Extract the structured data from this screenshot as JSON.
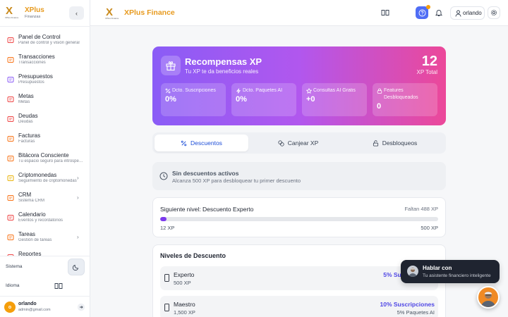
{
  "sidebar": {
    "brand_title": "XPlus",
    "brand_subtitle": "Finanzas",
    "logo_mark": "X",
    "logo_sub": "XPlus Finance",
    "items": [
      {
        "title": "Panel de Control",
        "subtitle": "Panel de control y visión general",
        "icon": "dashboard-icon",
        "color": "#ef4444",
        "chevron": false
      },
      {
        "title": "Transacciones",
        "subtitle": "Transacciones",
        "icon": "transactions-icon",
        "color": "#f97316",
        "chevron": false
      },
      {
        "title": "Presupuestos",
        "subtitle": "Presupuestos",
        "icon": "budget-icon",
        "color": "#8b5cf6",
        "chevron": false
      },
      {
        "title": "Metas",
        "subtitle": "Metas",
        "icon": "goals-icon",
        "color": "#ef4444",
        "chevron": false
      },
      {
        "title": "Deudas",
        "subtitle": "Deudas",
        "icon": "debts-icon",
        "color": "#ef4444",
        "chevron": false
      },
      {
        "title": "Facturas",
        "subtitle": "Facturas",
        "icon": "invoices-icon",
        "color": "#f97316",
        "chevron": false
      },
      {
        "title": "Bitácora Consciente",
        "subtitle": "Tu espacio seguro para introspección",
        "icon": "journal-icon",
        "color": "#f97316",
        "chevron": false
      },
      {
        "title": "Criptomonedas",
        "subtitle": "Seguimiento de criptomonedas",
        "icon": "crypto-icon",
        "color": "#eab308",
        "chevron": true
      },
      {
        "title": "CRM",
        "subtitle": "Sistema CRM",
        "icon": "crm-icon",
        "color": "#f97316",
        "chevron": true
      },
      {
        "title": "Calendario",
        "subtitle": "Eventos y recordatorios",
        "icon": "calendar-icon",
        "color": "#ef4444",
        "chevron": false
      },
      {
        "title": "Tareas",
        "subtitle": "Gestión de tareas",
        "icon": "tasks-icon",
        "color": "#f97316",
        "chevron": true
      },
      {
        "title": "Reportes",
        "subtitle": "",
        "icon": "reports-icon",
        "color": "#ef4444",
        "chevron": false
      }
    ],
    "system_label": "Sistema",
    "language_label": "Idioma",
    "user": {
      "initial": "o",
      "name": "orlando",
      "email": "admin@gmail.com"
    }
  },
  "header": {
    "logo_mark": "X",
    "logo_sub": "XPlus Finance",
    "title": "XPlus Finance",
    "user_name": "orlando",
    "help_color": "#4f6df5",
    "notification_dot_color": "#f59e0b"
  },
  "rewards": {
    "title": "Recompensas XP",
    "subtitle": "Tu XP te da beneficios reales",
    "total_value": "12",
    "total_label": "XP Total",
    "stats": [
      {
        "label": "Dcto. Suscripciones",
        "value": "0%",
        "icon": "percent-icon"
      },
      {
        "label": "Dcto. Paquetes AI",
        "value": "0%",
        "icon": "bolt-icon"
      },
      {
        "label": "Consultas AI Gratis",
        "value": "+0",
        "icon": "star-icon"
      },
      {
        "label": "Features Desbloqueados",
        "value": "0",
        "icon": "lock-icon"
      }
    ],
    "gradient": [
      "#8a5cf6",
      "#b157ee",
      "#ec4899"
    ]
  },
  "tabs": [
    {
      "label": "Descuentos",
      "icon": "percent-icon",
      "active": true
    },
    {
      "label": "Canjear XP",
      "icon": "coins-icon",
      "active": false
    },
    {
      "label": "Desbloqueos",
      "icon": "unlock-icon",
      "active": false
    }
  ],
  "empty_discounts": {
    "title": "Sin descuentos activos",
    "subtitle": "Alcanza 500 XP para desbloquear tu primer descuento"
  },
  "next_level": {
    "title": "Siguiente nivel: Descuento Experto",
    "remaining": "Faltan 488 XP",
    "current_label": "12 XP",
    "target_label": "500 XP",
    "progress": 0.024
  },
  "levels": {
    "title": "Niveles de Descuento",
    "items": [
      {
        "name": "Experto",
        "xp": "500 XP",
        "main": "5% Suscripciones",
        "secondary": ""
      },
      {
        "name": "Maestro",
        "xp": "1,500 XP",
        "main": "10% Suscripciones",
        "secondary": "5% Paquetes AI"
      }
    ]
  },
  "chat": {
    "title": "Hablar con",
    "subtitle": "Tu asistente financiero inteligente"
  }
}
